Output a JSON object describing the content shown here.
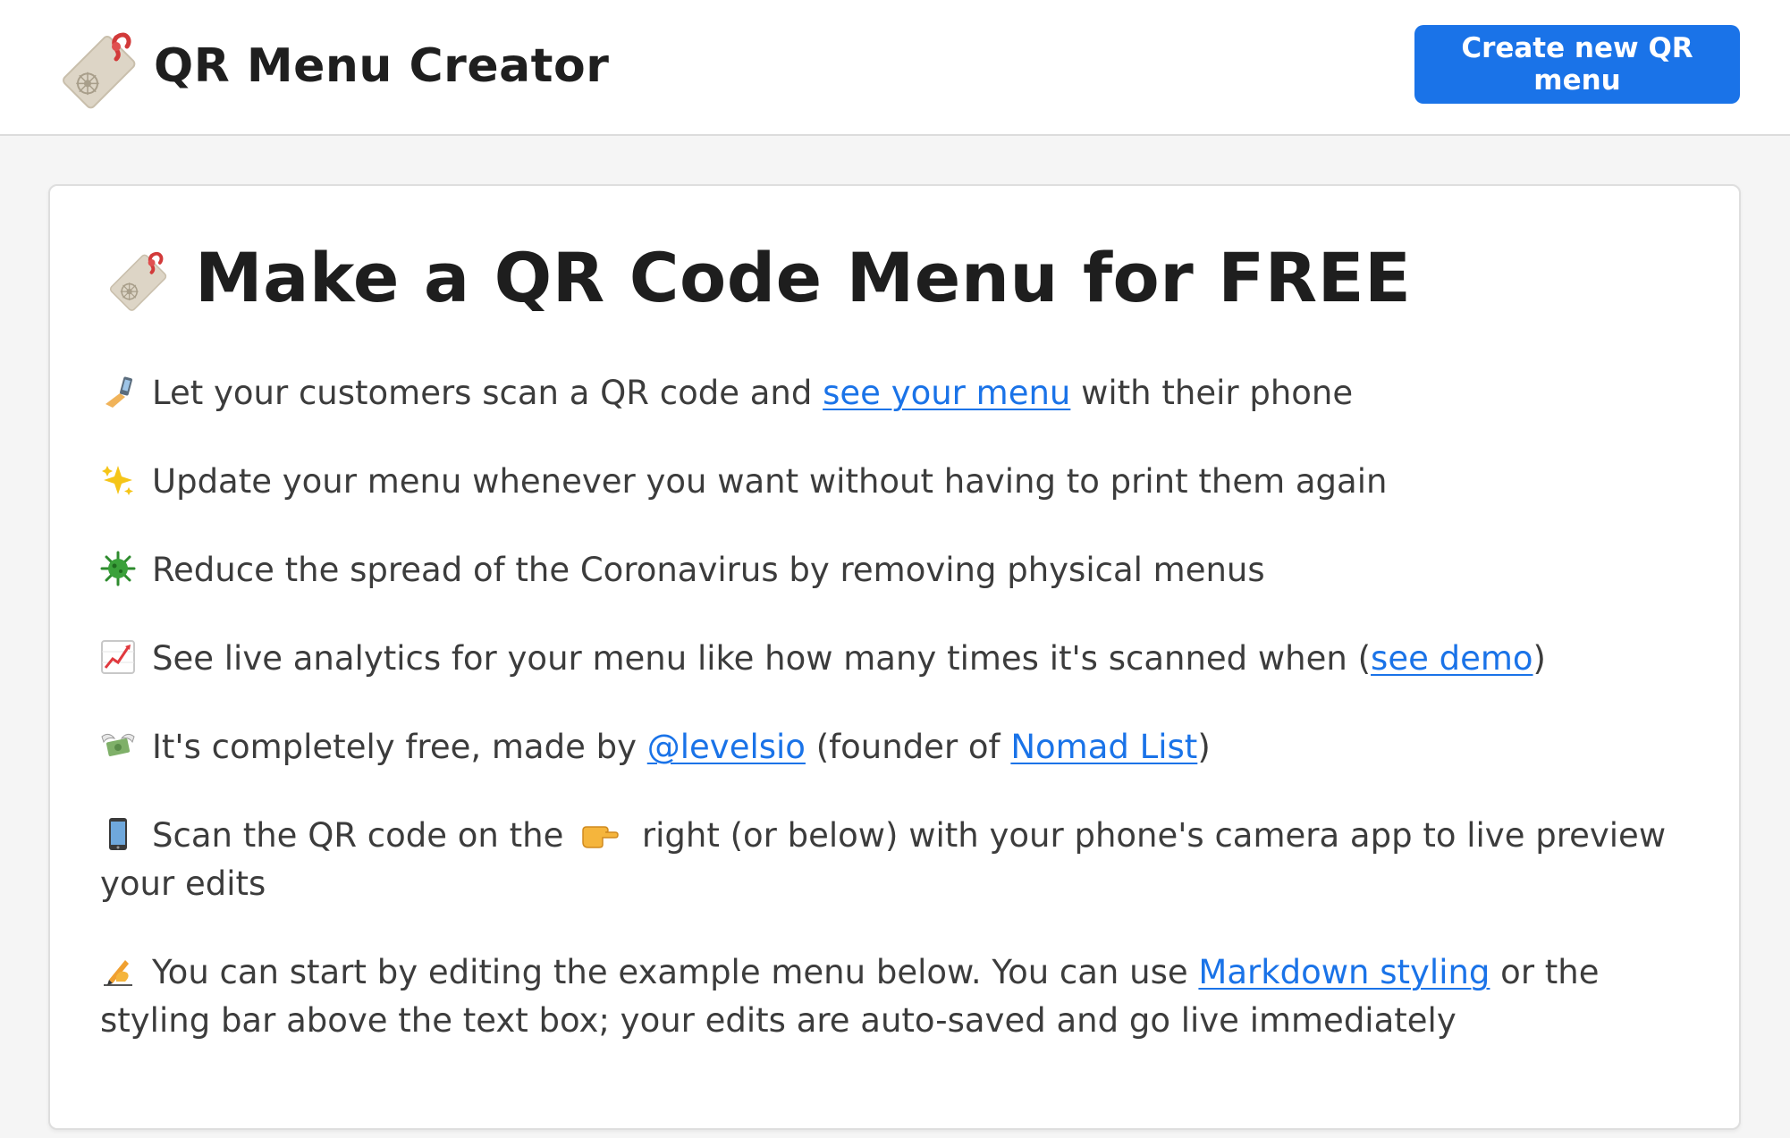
{
  "header": {
    "title": "QR Menu Creator",
    "cta_label": "Create new QR menu"
  },
  "card": {
    "heading": "Make a QR Code Menu for FREE",
    "items": [
      {
        "icon": "selfie-icon",
        "before": "Let your customers scan a QR code and ",
        "link": "see your menu",
        "after": " with their phone"
      },
      {
        "icon": "sparkles-icon",
        "text": "Update your menu whenever you want without having to print them again"
      },
      {
        "icon": "microbe-icon",
        "text": "Reduce the spread of the Coronavirus by removing physical menus"
      },
      {
        "icon": "chart-increasing-icon",
        "before": "See live analytics for your menu like how many times it's scanned when (",
        "link": "see demo",
        "after": ")"
      },
      {
        "icon": "money-with-wings-icon",
        "before": "It's completely free, made by ",
        "link1": "@levelsio",
        "middle": " (founder of ",
        "link2": "Nomad List",
        "after": ")"
      },
      {
        "icon": "mobile-phone-icon",
        "before": "Scan the QR code on the ",
        "pointer": "pointing-right-icon",
        "after": " right (or below) with your phone's camera app to live preview your edits"
      },
      {
        "icon": "writing-hand-icon",
        "before": "You can start by editing the example menu below. You can use ",
        "link": "Markdown styling",
        "after": " or the styling bar above the text box; your edits are auto-saved and go live immediately"
      }
    ]
  },
  "colors": {
    "accent": "#1a73e8",
    "background": "#f5f5f5",
    "card": "#ffffff",
    "text": "#3c3c3c"
  }
}
